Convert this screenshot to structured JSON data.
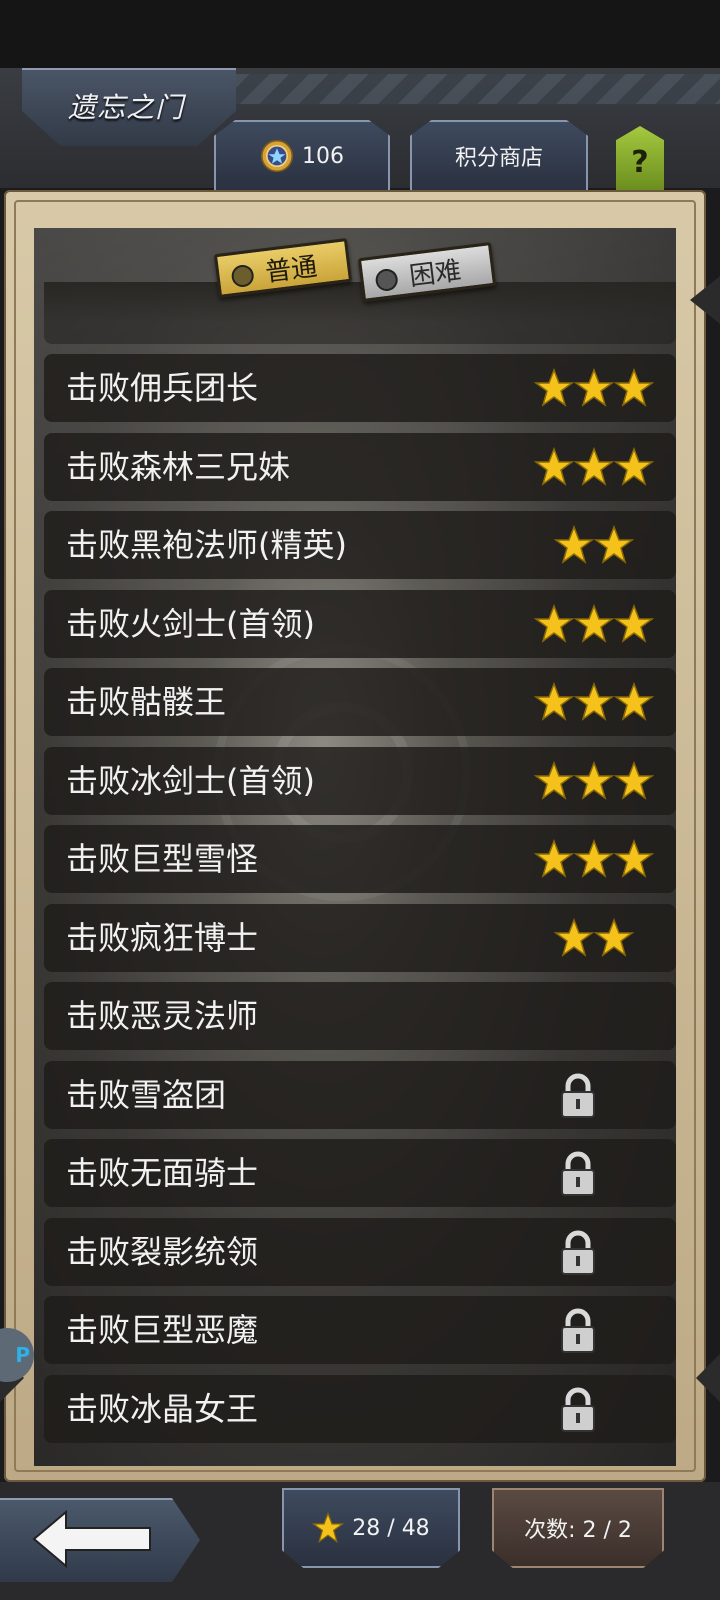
{
  "header": {
    "title": "遗忘之门",
    "points": "106",
    "shop_label": "积分商店",
    "help_label": "?"
  },
  "tabs": [
    {
      "label": "普通",
      "selected": true
    },
    {
      "label": "困难",
      "selected": false
    }
  ],
  "side_badge": "P",
  "quests": [
    {
      "label": "击败佣兵团长",
      "stars": 3,
      "locked": false
    },
    {
      "label": "击败森林三兄妹",
      "stars": 3,
      "locked": false
    },
    {
      "label": "击败黑袍法师(精英)",
      "stars": 2,
      "locked": false
    },
    {
      "label": "击败火剑士(首领)",
      "stars": 3,
      "locked": false
    },
    {
      "label": "击败骷髅王",
      "stars": 3,
      "locked": false
    },
    {
      "label": "击败冰剑士(首领)",
      "stars": 3,
      "locked": false
    },
    {
      "label": "击败巨型雪怪",
      "stars": 3,
      "locked": false
    },
    {
      "label": "击败疯狂博士",
      "stars": 2,
      "locked": false
    },
    {
      "label": "击败恶灵法师",
      "stars": 0,
      "locked": false
    },
    {
      "label": "击败雪盗团",
      "stars": 0,
      "locked": true
    },
    {
      "label": "击败无面骑士",
      "stars": 0,
      "locked": true
    },
    {
      "label": "击败裂影统领",
      "stars": 0,
      "locked": true
    },
    {
      "label": "击败巨型恶魔",
      "stars": 0,
      "locked": true
    },
    {
      "label": "击败冰晶女王",
      "stars": 0,
      "locked": true
    }
  ],
  "footer": {
    "stars_progress": "28 / 48",
    "attempts": "次数: 2 / 2"
  },
  "colors": {
    "star": "#f5c21b",
    "tab_selected": "#e2c25c",
    "frame": "#cdbb95"
  }
}
